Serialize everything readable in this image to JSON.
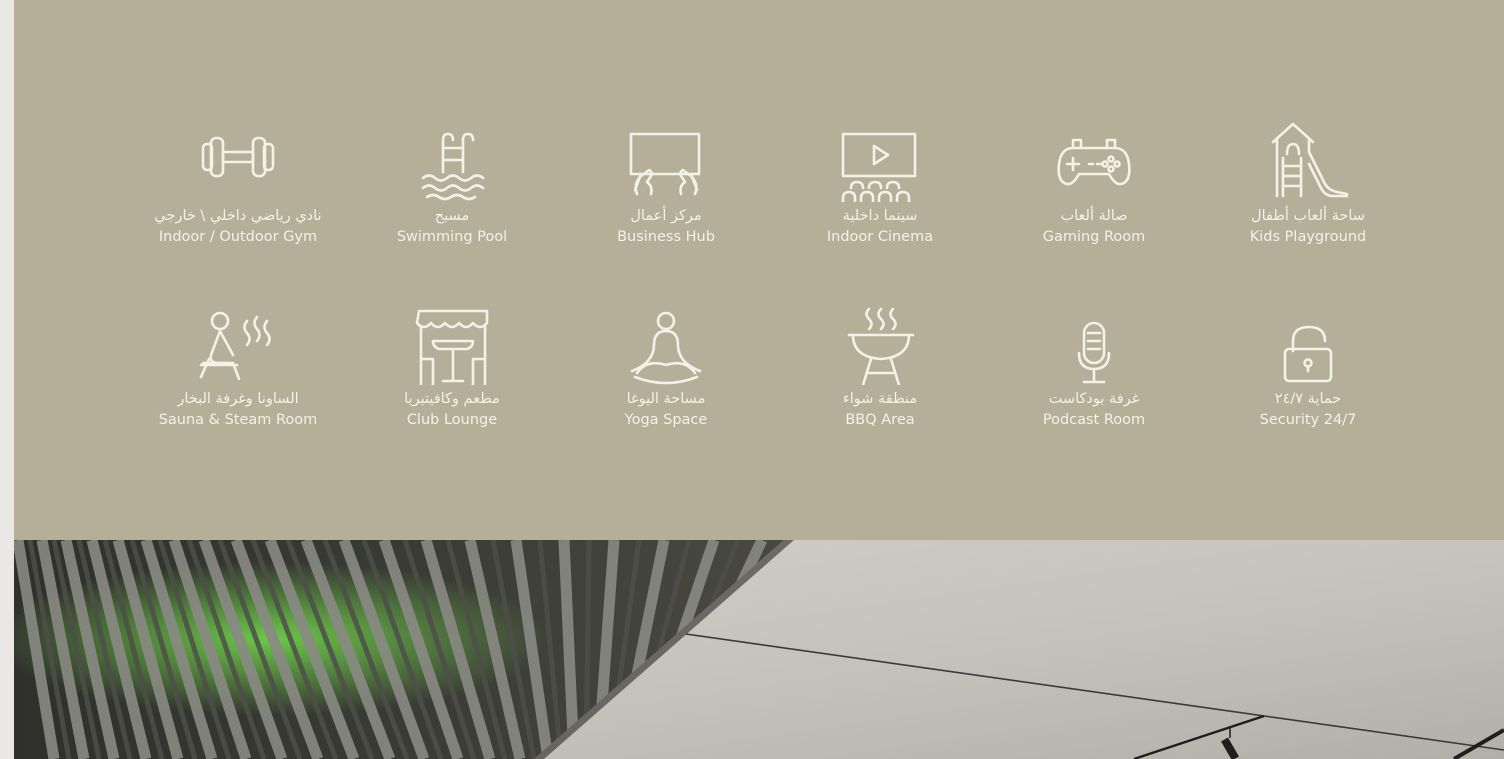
{
  "colors": {
    "panel": "#b5ae99",
    "text": "#f5f1e8",
    "ceiling": "#c6c3bd",
    "slats": "#5c5b55",
    "accent_green": "#5fb247"
  },
  "amenities": [
    {
      "icon": "dumbbell-icon",
      "ar": "نادي رياضي داخلي \\ خارجي",
      "en": "Indoor / Outdoor Gym"
    },
    {
      "icon": "pool-ladder-icon",
      "ar": "مسبح",
      "en": "Swimming Pool"
    },
    {
      "icon": "laptop-hands-icon",
      "ar": "مركز أعمال",
      "en": "Business Hub"
    },
    {
      "icon": "cinema-icon",
      "ar": "سينما داخلية",
      "en": "Indoor Cinema"
    },
    {
      "icon": "gamepad-icon",
      "ar": "صالة ألعاب",
      "en": "Gaming Room"
    },
    {
      "icon": "playground-slide-icon",
      "ar": "ساحة ألعاب أطفال",
      "en": "Kids Playground"
    },
    {
      "icon": "sauna-icon",
      "ar": "الساونا وغرفة البخار",
      "en": "Sauna & Steam Room"
    },
    {
      "icon": "cafe-awning-icon",
      "ar": "مطعم وكافيتيريا",
      "en": "Club Lounge"
    },
    {
      "icon": "yoga-icon",
      "ar": "مساحة اليوغا",
      "en": "Yoga Space"
    },
    {
      "icon": "bbq-grill-icon",
      "ar": "منطقة شواء",
      "en": "BBQ Area"
    },
    {
      "icon": "microphone-icon",
      "ar": "غرفة بودكاست",
      "en": "Podcast Room"
    },
    {
      "icon": "unlocked-padlock-icon",
      "ar": "حماية ٢٤/٧",
      "en": "Security 24/7"
    }
  ]
}
